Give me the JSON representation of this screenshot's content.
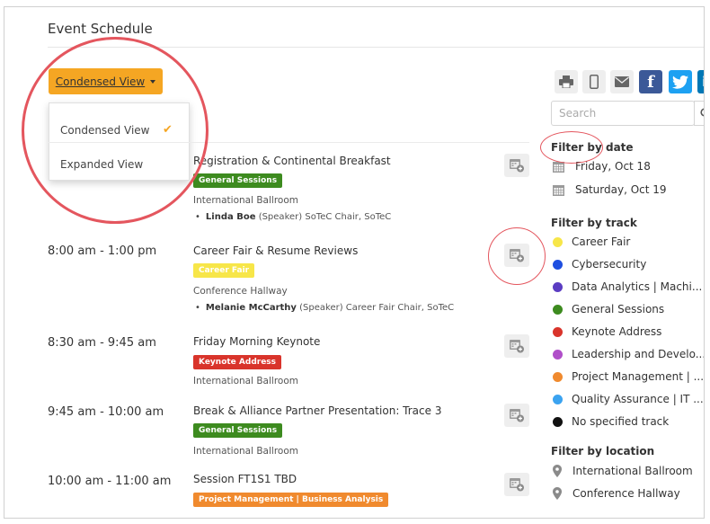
{
  "page": {
    "title": "Event Schedule"
  },
  "view_toggle": {
    "label": "Condensed View",
    "options": [
      "Condensed View",
      "Expanded View"
    ],
    "selected": "Condensed View"
  },
  "events": [
    {
      "time": "",
      "title": "Registration & Continental Breakfast",
      "track": "General Sessions",
      "track_color": "#3d8b1f",
      "location": "International Ballroom",
      "speaker_name": "Linda Boe",
      "speaker_role": "(Speaker) SoTeC Chair, SoTeC"
    },
    {
      "time": "8:00 am - 1:00 pm",
      "title": "Career Fair & Resume Reviews",
      "track": "Career Fair",
      "track_color": "#f7e649",
      "location": "Conference Hallway",
      "speaker_name": "Melanie McCarthy",
      "speaker_role": "(Speaker) Career Fair Chair, SoTeC"
    },
    {
      "time": "8:30 am - 9:45 am",
      "title": "Friday Morning Keynote",
      "track": "Keynote Address",
      "track_color": "#d9342b",
      "location": "International Ballroom"
    },
    {
      "time": "9:45 am - 10:00 am",
      "title": "Break & Alliance Partner Presentation: Trace 3",
      "track": "General Sessions",
      "track_color": "#3d8b1f",
      "location": "International Ballroom"
    },
    {
      "time": "10:00 am - 11:00 am",
      "title": "Session FT1S1 TBD",
      "track": "Project Management | Business Analysis",
      "track_color": "#f08a2e"
    }
  ],
  "search": {
    "placeholder": "Search"
  },
  "filters": {
    "date_heading": "Filter by date",
    "dates": [
      "Friday, Oct 18",
      "Saturday, Oct 19"
    ],
    "track_heading": "Filter by track",
    "tracks": [
      {
        "label": "Career Fair",
        "color": "#f7e649"
      },
      {
        "label": "Cybersecurity",
        "color": "#1f4fe0"
      },
      {
        "label": "Data Analytics | Machi...",
        "color": "#5b3dc2"
      },
      {
        "label": "General Sessions",
        "color": "#3d8b1f"
      },
      {
        "label": "Keynote Address",
        "color": "#d9342b"
      },
      {
        "label": "Leadership and Develo...",
        "color": "#b04fc9"
      },
      {
        "label": "Project Management | ...",
        "color": "#f08a2e"
      },
      {
        "label": "Quality Assurance | IT ...",
        "color": "#3ba3f0"
      },
      {
        "label": "No specified track",
        "color": "#111111"
      }
    ],
    "location_heading": "Filter by location",
    "locations": [
      "International Ballroom",
      "Conference Hallway"
    ]
  },
  "colors": {
    "accent": "#f5a623",
    "annotation": "#e4565e"
  }
}
